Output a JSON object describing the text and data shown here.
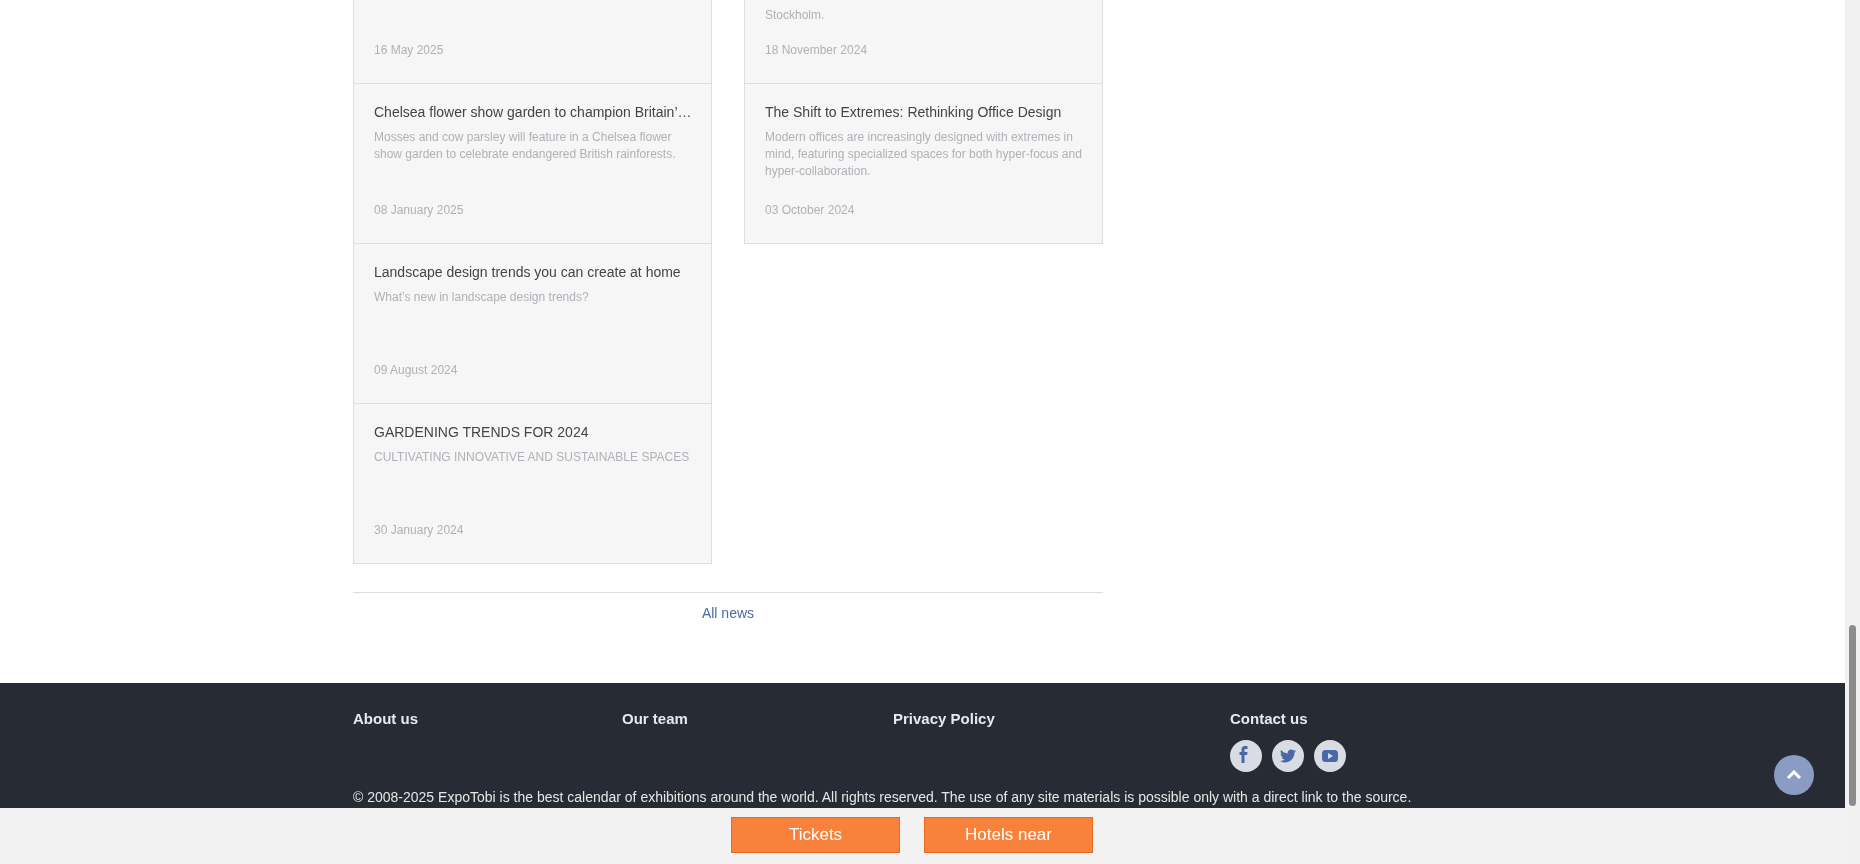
{
  "news_columns": [
    [
      {
        "date": "16 May 2025"
      },
      {
        "title": "Chelsea flower show garden to champion Britain’…",
        "description": "Mosses and cow parsley will feature in a Chelsea flower show garden to celebrate endangered British rainforests.",
        "date": "08 January 2025"
      },
      {
        "title": "Landscape design trends you can create at home",
        "description": "What’s new in landscape design trends?",
        "date": "09 August 2024"
      },
      {
        "title": "GARDENING TRENDS FOR 2024",
        "description": "CULTIVATING INNOVATIVE AND SUSTAINABLE SPACES",
        "date": "30 January 2024"
      }
    ],
    [
      {
        "description": "Stockholm.",
        "date": "18 November 2024"
      },
      {
        "title": "The Shift to Extremes: Rethinking Office Design",
        "description": "Modern offices are increasingly designed with extremes in mind, featuring specialized spaces for both hyper-focus and hyper-collaboration.",
        "date": "03 October 2024"
      }
    ]
  ],
  "all_news_link": "All news",
  "footer": {
    "links": [
      "About us",
      "Our team",
      "Privacy Policy",
      "Contact us"
    ],
    "social": [
      {
        "kind": "facebook"
      },
      {
        "kind": "twitter"
      },
      {
        "kind": "youtube"
      }
    ],
    "copyright": "© 2008-2025 ExpoTobi is the best calendar of exhibitions around the world. All rights reserved. The use of any site materials is possible only with a direct link to the source."
  },
  "bottom_buttons": [
    "Tickets",
    "Hotels near"
  ]
}
